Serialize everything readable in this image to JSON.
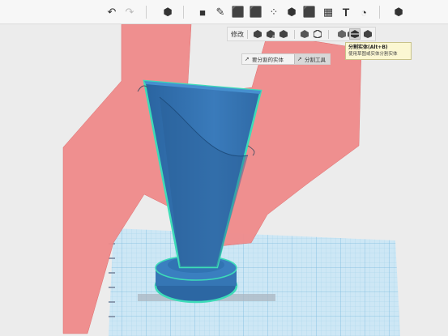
{
  "toolbar": {
    "buttons": [
      {
        "name": "undo-icon",
        "glyph": "↶"
      },
      {
        "name": "redo-icon",
        "glyph": "↷"
      },
      {
        "name": "add-primitive-icon",
        "glyph": "⬢"
      },
      {
        "name": "box-icon",
        "glyph": "■"
      },
      {
        "name": "sketch-icon",
        "glyph": "✎"
      },
      {
        "name": "construct-icon",
        "glyph": "⬛"
      },
      {
        "name": "modify-icon",
        "glyph": "⬛"
      },
      {
        "name": "pattern-icon",
        "glyph": "⁘"
      },
      {
        "name": "group-icon",
        "glyph": "⬢"
      },
      {
        "name": "combine-icon",
        "glyph": "⬛"
      },
      {
        "name": "measure-icon",
        "glyph": "▦"
      },
      {
        "name": "text-icon",
        "glyph": "T"
      },
      {
        "name": "material-icon",
        "glyph": "◔"
      },
      {
        "name": "view-cube-icon",
        "glyph": "⬢"
      }
    ]
  },
  "sub_toolbar": {
    "label": "修改",
    "buttons": [
      {
        "name": "press-pull-icon",
        "glyph": "⬛"
      },
      {
        "name": "tweak-icon",
        "glyph": "⬛"
      },
      {
        "name": "fillet-icon",
        "glyph": "⬛"
      },
      {
        "name": "chamfer-icon",
        "glyph": "⬛"
      },
      {
        "name": "shell-icon",
        "glyph": "⬛"
      },
      {
        "name": "split-solid-icon",
        "glyph": "⬛"
      },
      {
        "name": "split-face-icon",
        "glyph": "⬛"
      }
    ]
  },
  "tooltip": {
    "title": "分割实体(Alt+B)",
    "description": "使用草图或实体分割实体"
  },
  "mode_bar": {
    "items": [
      {
        "label": "要分割的实体",
        "icon": "cursor-icon"
      },
      {
        "label": "分割工具",
        "icon": "cursor-icon"
      }
    ]
  },
  "colors": {
    "toolbar_bg": "#f7f7f7",
    "sketch_plane": "#f08b8b",
    "solid_blue": "#2f6fad",
    "selection_outline": "#3ddcb8",
    "grid_blue": "#b9dcf0",
    "tooltip_bg": "#fbf7d2"
  }
}
